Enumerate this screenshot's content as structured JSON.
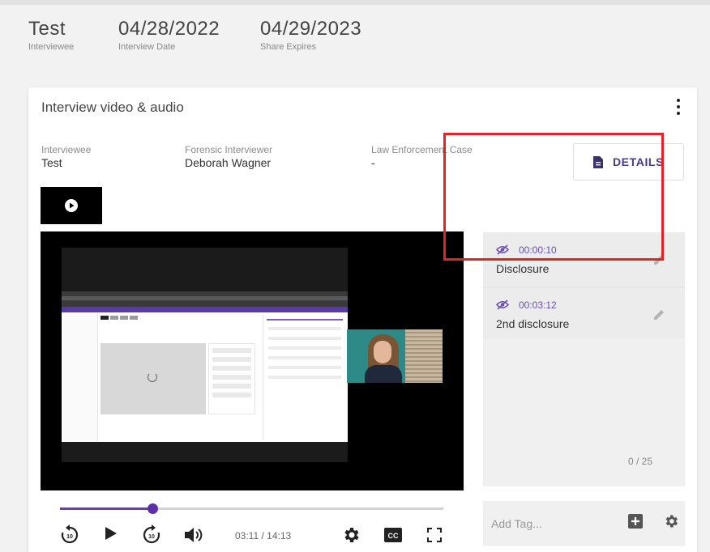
{
  "header": {
    "interviewee_value": "Test",
    "interviewee_label": "Interviewee",
    "date_value": "04/28/2022",
    "date_label": "Interview Date",
    "expires_value": "04/29/2023",
    "expires_label": "Share Expires"
  },
  "card": {
    "title": "Interview video & audio",
    "interviewee_label": "Interviewee",
    "interviewee_value": "Test",
    "interviewer_label": "Forensic Interviewer",
    "interviewer_value": "Deborah Wagner",
    "case_label": "Law Enforcement Case",
    "case_value": "-",
    "details_label": "DETAILS"
  },
  "player": {
    "current_time": "03:11 / 14:13",
    "progress_fraction": 0.24
  },
  "tags": {
    "items": [
      {
        "time": "00:00:10",
        "label": "Disclosure"
      },
      {
        "time": "00:03:12",
        "label": "2nd disclosure"
      }
    ],
    "add_placeholder": "Add Tag...",
    "count": "0 / 25"
  },
  "colors": {
    "accent": "#6b3db5",
    "highlight_border": "#e0242a",
    "details_text": "#4a3a8c"
  },
  "icons": [
    "kebab-menu-icon",
    "document-icon",
    "play-icon",
    "replay-10-icon",
    "forward-10-icon",
    "volume-icon",
    "settings-icon",
    "closed-captions-icon",
    "fullscreen-icon",
    "eye-off-icon",
    "edit-pencil-icon",
    "add-box-icon"
  ]
}
